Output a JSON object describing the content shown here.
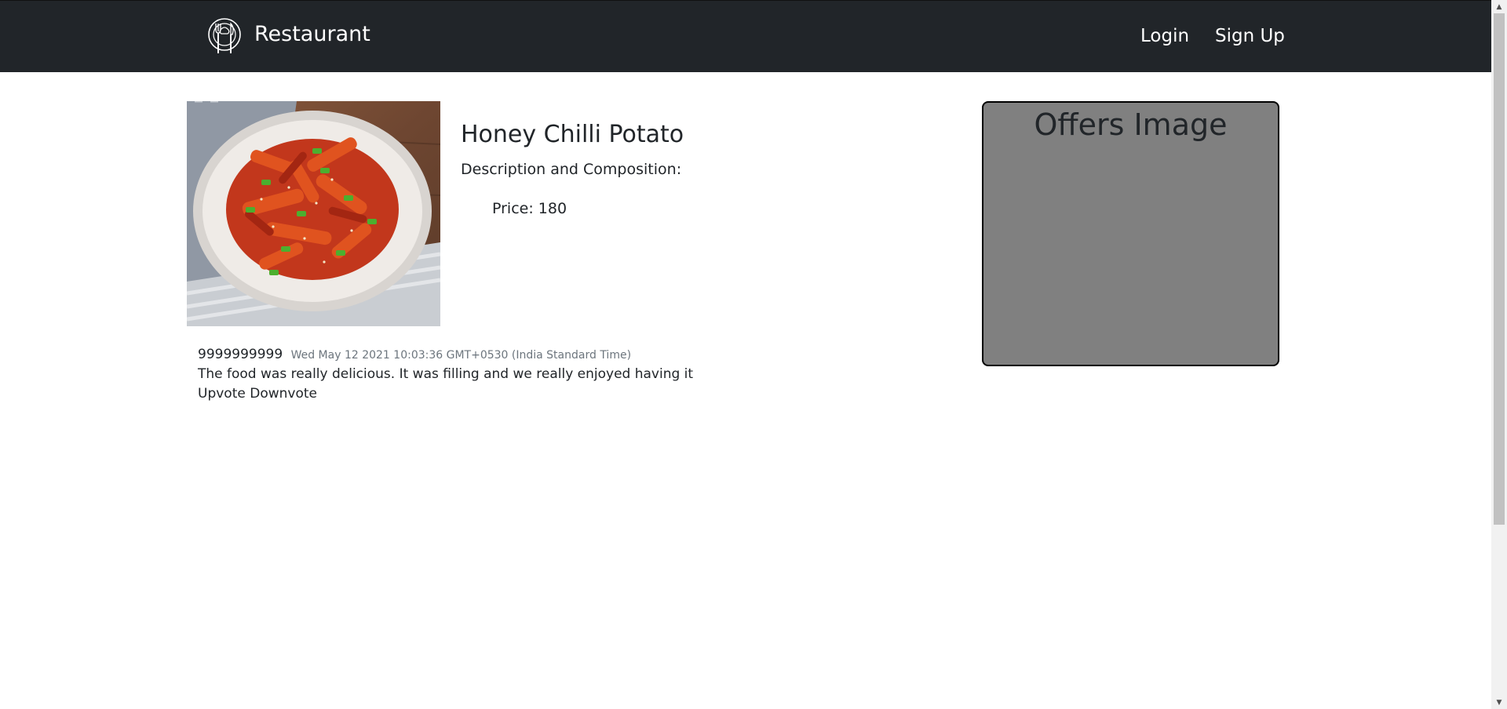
{
  "navbar": {
    "brand_text": "Restaurant",
    "logo_icon": "chef-plate-icon",
    "login": "Login",
    "signup": "Sign Up",
    "bg_color": "#212529"
  },
  "item": {
    "image_icon": "honey-chilli-potato-photo",
    "title": "Honey Chilli Potato",
    "description": "Description and Composition:",
    "price": "Price: 180"
  },
  "comment": {
    "user": "9999999999",
    "date": "Wed May 12 2021 10:03:36 GMT+0530 (India Standard Time)",
    "text": "The food was really delicious. It was filling and we really enjoyed having it",
    "upvote": "Upvote",
    "downvote": "Downvote"
  },
  "offers": {
    "title": "Offers Image",
    "bg_color": "#808080"
  },
  "scrollbar": {
    "up_icon": "scroll-up-arrow-icon",
    "down_icon": "scroll-down-arrow-icon"
  }
}
